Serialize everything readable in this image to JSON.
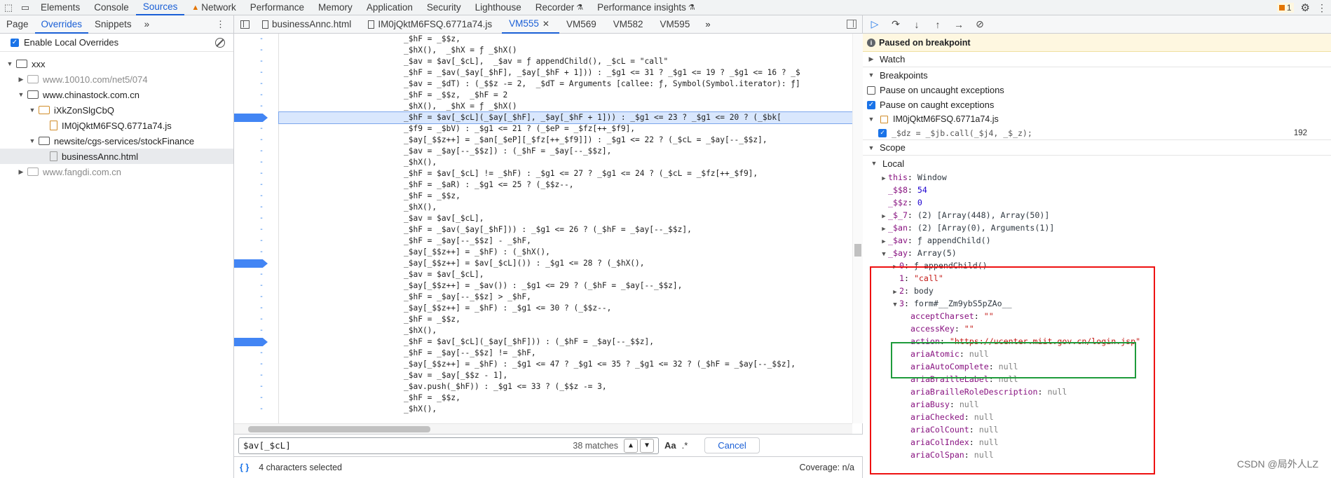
{
  "top_tabs": [
    "Elements",
    "Console",
    "Sources",
    "Network",
    "Performance",
    "Memory",
    "Application",
    "Security",
    "Lighthouse",
    "Recorder",
    "Performance insights"
  ],
  "active_top_tab": "Sources",
  "issue_count": "1",
  "left": {
    "subtabs": [
      "Page",
      "Overrides",
      "Snippets"
    ],
    "enable_overrides": "Enable Local Overrides",
    "tree": [
      {
        "label": "xxx",
        "indent": 0,
        "type": "folder",
        "open": true
      },
      {
        "label": "www.10010.com/net5/074",
        "indent": 1,
        "type": "folder-grey",
        "open": false
      },
      {
        "label": "www.chinastock.com.cn",
        "indent": 1,
        "type": "folder",
        "open": true
      },
      {
        "label": "iXkZonSlgCbQ",
        "indent": 2,
        "type": "folder-orange",
        "open": true
      },
      {
        "label": "IM0jQktM6FSQ.6771a74.js",
        "indent": 3,
        "type": "file"
      },
      {
        "label": "newsite/cgs-services/stockFinance",
        "indent": 2,
        "type": "folder",
        "open": true
      },
      {
        "label": "businessAnnc.html",
        "indent": 3,
        "type": "file-grey",
        "selected": true
      },
      {
        "label": "www.fangdi.com.cn",
        "indent": 1,
        "type": "folder-grey",
        "open": false
      }
    ]
  },
  "center": {
    "file_tabs": [
      "businessAnnc.html",
      "IM0jQktM6FSQ.6771a74.js",
      "VM555",
      "VM569",
      "VM582",
      "VM595"
    ],
    "active_file_tab": "VM555",
    "search_value": "$av[_$cL]",
    "matches": "38 matches",
    "aa": "Aa",
    "regex": ".*",
    "cancel": "Cancel",
    "status_selected": "4 characters selected",
    "coverage": "Coverage: n/a"
  },
  "code_lines": [
    {
      "text": "_$hF = _$$z,",
      "bp": false
    },
    {
      "text": "_$hX(),  _$hX = ƒ _$hX()",
      "bp": false
    },
    {
      "text": "_$av = $av[_$cL],  _$av = ƒ appendChild(), _$cL = \"call\"",
      "bp": false
    },
    {
      "text": "_$hF = _$av(_$ay[_$hF], _$ay[_$hF + 1])) : _$g1 <= 31 ? _$g1 <= 19 ? _$g1 <= 16 ? _$",
      "bp": false
    },
    {
      "text": "_$av = _$dT) : (_$$z -= 2,  _$dT = Arguments [callee: ƒ, Symbol(Symbol.iterator): ƒ]",
      "bp": false
    },
    {
      "text": "_$hF = _$$z,  _$hF = 2",
      "bp": false
    },
    {
      "text": "_$hX(),  _$hX = ƒ _$hX()",
      "bp": false
    },
    {
      "text": "_$hF = $av[_$cL](_$ay[_$hF], _$ay[_$hF + 1])) : _$g1 <= 23 ? _$g1 <= 20 ? (_$bk[",
      "bp": true,
      "hl": true
    },
    {
      "text": "_$f9 = _$bV) : _$g1 <= 21 ? (_$eP = _$fz[++_$f9],",
      "bp": false
    },
    {
      "text": "_$ay[_$$z++] = _$an[_$eP][_$fz[++_$f9]]) : _$g1 <= 22 ? (_$cL = _$ay[--_$$z],",
      "bp": false
    },
    {
      "text": "_$av = _$ay[--_$$z]) : (_$hF = _$ay[--_$$z],",
      "bp": false
    },
    {
      "text": "_$hX(),",
      "bp": false
    },
    {
      "text": "_$hF = $av[_$cL] != _$hF) : _$g1 <= 27 ? _$g1 <= 24 ? (_$cL = _$fz[++_$f9],",
      "bp": false
    },
    {
      "text": "_$hF = _$aR) : _$g1 <= 25 ? (_$$z--,",
      "bp": false
    },
    {
      "text": "_$hF = _$$z,",
      "bp": false
    },
    {
      "text": "_$hX(),",
      "bp": false
    },
    {
      "text": "_$av = $av[_$cL],",
      "bp": false
    },
    {
      "text": "_$hF = _$av(_$ay[_$hF])) : _$g1 <= 26 ? (_$hF = _$ay[--_$$z],",
      "bp": false
    },
    {
      "text": "_$hF = _$ay[--_$$z] - _$hF,",
      "bp": false
    },
    {
      "text": "_$ay[_$$z++] = _$hF) : (_$hX(),",
      "bp": false
    },
    {
      "text": "_$ay[_$$z++] = $av[_$cL]()) : _$g1 <= 28 ? (_$hX(),",
      "bp": true
    },
    {
      "text": "_$av = $av[_$cL],",
      "bp": false
    },
    {
      "text": "_$ay[_$$z++] = _$av()) : _$g1 <= 29 ? (_$hF = _$ay[--_$$z],",
      "bp": false
    },
    {
      "text": "_$hF = _$ay[--_$$z] > _$hF,",
      "bp": false
    },
    {
      "text": "_$ay[_$$z++] = _$hF) : _$g1 <= 30 ? (_$$z--,",
      "bp": false
    },
    {
      "text": "_$hF = _$$z,",
      "bp": false
    },
    {
      "text": "_$hX(),",
      "bp": false
    },
    {
      "text": "_$hF = $av[_$cL](_$ay[_$hF])) : (_$hF = _$ay[--_$$z],",
      "bp": true
    },
    {
      "text": "_$hF = _$ay[--_$$z] != _$hF,",
      "bp": false
    },
    {
      "text": "_$ay[_$$z++] = _$hF) : _$g1 <= 47 ? _$g1 <= 35 ? _$g1 <= 32 ? (_$hF = _$ay[--_$$z],",
      "bp": false
    },
    {
      "text": "_$av = _$ay[_$$z - 1],",
      "bp": false
    },
    {
      "text": "_$av.push(_$hF)) : _$g1 <= 33 ? (_$$z -= 3,",
      "bp": false
    },
    {
      "text": "_$hF = _$$z,",
      "bp": false
    },
    {
      "text": "_$hX(),",
      "bp": false
    }
  ],
  "right": {
    "paused": "Paused on breakpoint",
    "watch": "Watch",
    "breakpoints": "Breakpoints",
    "pause_uncaught": "Pause on uncaught exceptions",
    "pause_caught": "Pause on caught exceptions",
    "bp_file": "IM0jQktM6FSQ.6771a74.js",
    "bp_code": "_$dz = _$jb.call(_$j4, _$_z);",
    "bp_line": "192",
    "scope": "Scope",
    "local": "Local",
    "scope_rows": [
      {
        "indent": 1,
        "tri": "▶",
        "key": "this",
        "val": "Window",
        "vclass": "o"
      },
      {
        "indent": 1,
        "tri": "",
        "key": "_$$8",
        "val": "54",
        "vclass": "n"
      },
      {
        "indent": 1,
        "tri": "",
        "key": "_$$z",
        "val": "0",
        "vclass": "n"
      },
      {
        "indent": 1,
        "tri": "▶",
        "key": "_$_7",
        "val": "(2) [Array(448), Array(50)]",
        "vclass": "o"
      },
      {
        "indent": 1,
        "tri": "▶",
        "key": "_$an",
        "val": "(2) [Array(0), Arguments(1)]",
        "vclass": "o"
      },
      {
        "indent": 1,
        "tri": "▶",
        "key": "_$av",
        "val": "ƒ appendChild()",
        "vclass": "o"
      },
      {
        "indent": 1,
        "tri": "▼",
        "key": "_$ay",
        "val": "Array(5)",
        "vclass": "o"
      },
      {
        "indent": 2,
        "tri": "▶",
        "key": "0",
        "val": "ƒ appendChild()",
        "vclass": "o"
      },
      {
        "indent": 2,
        "tri": "",
        "key": "1",
        "val": "\"call\"",
        "vclass": "s"
      },
      {
        "indent": 2,
        "tri": "▶",
        "key": "2",
        "val": "body",
        "vclass": "o"
      },
      {
        "indent": 2,
        "tri": "▼",
        "key": "3",
        "val": "form#__Zm9ybS5pZAo__",
        "vclass": "o"
      },
      {
        "indent": 3,
        "tri": "",
        "key": "acceptCharset",
        "val": "\"\"",
        "vclass": "s"
      },
      {
        "indent": 3,
        "tri": "",
        "key": "accessKey",
        "val": "\"\"",
        "vclass": "s"
      },
      {
        "indent": 3,
        "tri": "",
        "key": "action",
        "val": "\"https://ucenter.miit.gov.cn/login.jsp\"",
        "vclass": "s"
      },
      {
        "indent": 3,
        "tri": "",
        "key": "ariaAtomic",
        "val": "null",
        "vclass": "nul"
      },
      {
        "indent": 3,
        "tri": "",
        "key": "ariaAutoComplete",
        "val": "null",
        "vclass": "nul"
      },
      {
        "indent": 3,
        "tri": "",
        "key": "ariaBrailleLabel",
        "val": "null",
        "vclass": "nul"
      },
      {
        "indent": 3,
        "tri": "",
        "key": "ariaBrailleRoleDescription",
        "val": "null",
        "vclass": "nul"
      },
      {
        "indent": 3,
        "tri": "",
        "key": "ariaBusy",
        "val": "null",
        "vclass": "nul"
      },
      {
        "indent": 3,
        "tri": "",
        "key": "ariaChecked",
        "val": "null",
        "vclass": "nul"
      },
      {
        "indent": 3,
        "tri": "",
        "key": "ariaColCount",
        "val": "null",
        "vclass": "nul"
      },
      {
        "indent": 3,
        "tri": "",
        "key": "ariaColIndex",
        "val": "null",
        "vclass": "nul"
      },
      {
        "indent": 3,
        "tri": "",
        "key": "ariaColSpan",
        "val": "null",
        "vclass": "nul"
      }
    ]
  },
  "watermark": "CSDN @局外人LZ"
}
